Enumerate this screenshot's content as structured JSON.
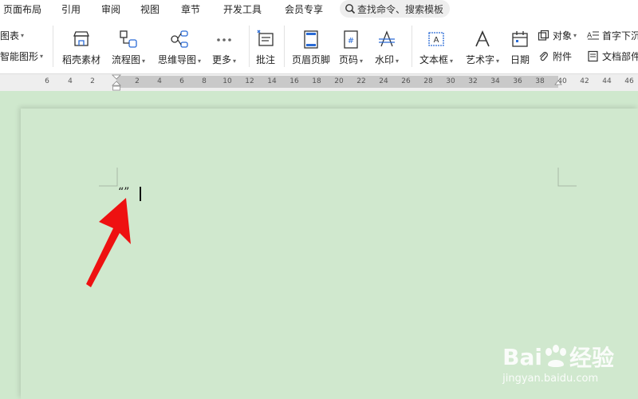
{
  "menubar": {
    "items": [
      "页面布局",
      "引用",
      "审阅",
      "视图",
      "章节",
      "开发工具",
      "会员专享"
    ],
    "search_placeholder": "查找命令、搜索模板"
  },
  "ribbon": {
    "left_partial_1": "图表",
    "left_partial_2": "智能图形",
    "buttons": {
      "daoke": "稻壳素材",
      "flow": "流程图",
      "mind": "思维导图",
      "more": "更多",
      "comment": "批注",
      "header_footer": "页眉页脚",
      "page_num": "页码",
      "watermark": "水印",
      "textbox": "文本框",
      "wordart": "艺术字",
      "date": "日期"
    },
    "small": {
      "object": "对象",
      "attachment": "附件",
      "dropcap": "首字下沉",
      "docpart": "文档部件"
    }
  },
  "ruler": {
    "labels": [
      "6",
      "4",
      "2",
      "2",
      "4",
      "6",
      "8",
      "10",
      "12",
      "14",
      "16",
      "18",
      "20",
      "22",
      "24",
      "26",
      "28",
      "30",
      "32",
      "34",
      "36",
      "38",
      "40",
      "42",
      "44",
      "46"
    ]
  },
  "document": {
    "content": "“”"
  },
  "watermark": {
    "brand": "Bai",
    "brand2": "经验",
    "url": "jingyan.baidu.com"
  },
  "colors": {
    "page_bg": "#cfe8cd",
    "arrow": "#ee1111",
    "ribbon_bg": "#ffffff"
  }
}
